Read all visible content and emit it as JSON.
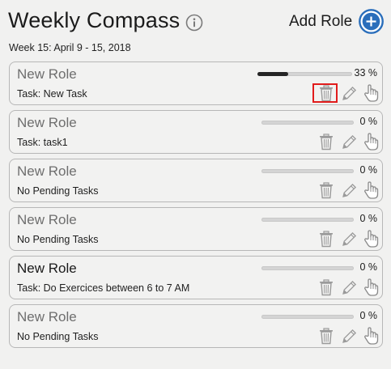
{
  "header": {
    "title": "Weekly Compass",
    "add_role_label": "Add Role",
    "week_label": "Week 15: April 9 - 15, 2018",
    "accent_color": "#2a6ebb"
  },
  "roles": [
    {
      "name": "New Role",
      "task": "Task: New Task",
      "progress_label": "33 %",
      "progress": 0.33,
      "highlighted_trash": true
    },
    {
      "name": "New Role",
      "task": "Task: task1",
      "progress_label": "0 %",
      "progress": 0
    },
    {
      "name": "New Role",
      "task": "No Pending Tasks",
      "progress_label": "0 %",
      "progress": 0
    },
    {
      "name": "New Role",
      "task": "No Pending Tasks",
      "progress_label": "0 %",
      "progress": 0
    },
    {
      "name": "New Role",
      "task": "Task: Do Exercices between 6 to 7 AM",
      "progress_label": "0 %",
      "progress": 0
    },
    {
      "name": "New Role",
      "task": "No Pending Tasks",
      "progress_label": "0 %",
      "progress": 0
    }
  ],
  "icons": {
    "info": "info-icon",
    "add": "plus-circle-icon",
    "delete": "trash-icon",
    "edit": "pencil-icon",
    "select": "hand-pointer-icon"
  }
}
